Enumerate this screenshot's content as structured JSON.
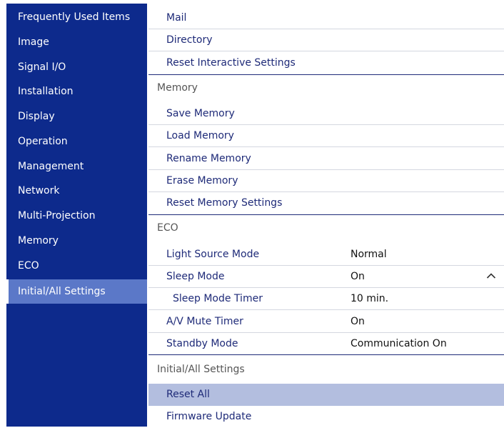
{
  "sidebar": {
    "items": [
      {
        "label": "Frequently Used Items"
      },
      {
        "label": "Image"
      },
      {
        "label": "Signal I/O"
      },
      {
        "label": "Installation"
      },
      {
        "label": "Display"
      },
      {
        "label": "Operation"
      },
      {
        "label": "Management"
      },
      {
        "label": "Network"
      },
      {
        "label": "Multi-Projection"
      },
      {
        "label": "Memory"
      },
      {
        "label": "ECO"
      },
      {
        "label": "Initial/All Settings",
        "selected": true
      }
    ]
  },
  "main": {
    "rows": {
      "mail": {
        "label": "Mail"
      },
      "directory": {
        "label": "Directory"
      },
      "reset_interactive": {
        "label": "Reset Interactive Settings"
      },
      "memory_header": {
        "label": "Memory"
      },
      "save_memory": {
        "label": "Save Memory"
      },
      "load_memory": {
        "label": "Load Memory"
      },
      "rename_memory": {
        "label": "Rename Memory"
      },
      "erase_memory": {
        "label": "Erase Memory"
      },
      "reset_memory": {
        "label": "Reset Memory Settings"
      },
      "eco_header": {
        "label": "ECO"
      },
      "light_source_mode": {
        "label": "Light Source Mode",
        "value": "Normal"
      },
      "sleep_mode": {
        "label": "Sleep Mode",
        "value": "On",
        "icon": "chevron-up-icon"
      },
      "sleep_mode_timer": {
        "label": "Sleep Mode Timer",
        "value": "10 min."
      },
      "av_mute_timer": {
        "label": "A/V Mute Timer",
        "value": "On"
      },
      "standby_mode": {
        "label": "Standby Mode",
        "value": "Communication On"
      },
      "initial_header": {
        "label": "Initial/All Settings"
      },
      "reset_all": {
        "label": "Reset All"
      },
      "firmware_update": {
        "label": "Firmware Update"
      }
    }
  },
  "colors": {
    "sidebar_bg": "#0d2a8c",
    "sidebar_selected": "#5b78c8",
    "item_text": "#1e2a78",
    "row_highlight": "#b3bedf",
    "divider": "#d4d7e0"
  }
}
